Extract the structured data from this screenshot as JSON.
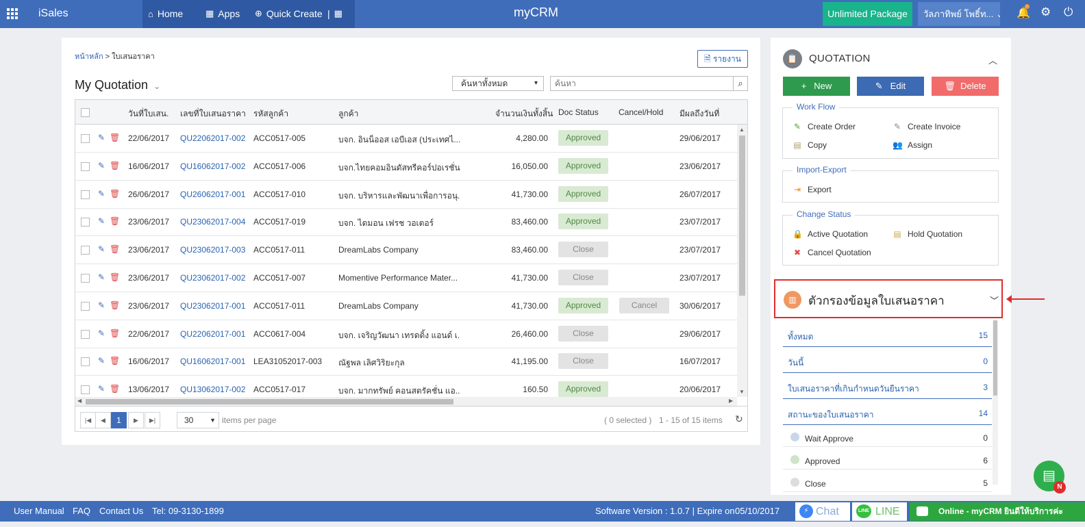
{
  "topbar": {
    "brand": "iSales",
    "nav": {
      "home": "Home",
      "apps": "Apps",
      "quick_create": "Quick Create"
    },
    "center_brand": "myCRM",
    "package": "Unlimited Package",
    "user": "วัลภาทิพย์ โพธิ์ท... ⌄"
  },
  "breadcrumb": {
    "home": "หน้าหลัก",
    "sep": ">",
    "current": "ใบเสนอราคา"
  },
  "report_button": "รายงาน",
  "page_title": "My Quotation",
  "search": {
    "scope": "ค้นหาทั้งหมด",
    "placeholder": "ค้นหา"
  },
  "grid": {
    "columns": [
      "วันที่ใบเสน...",
      "เลขที่ใบเสนอราคา",
      "รหัสลูกค้า",
      "ลูกค้า",
      "จำนวนเงินทั้งสิ้น",
      "Doc Status",
      "Cancel/Hold",
      "มีผลถึงวันที่"
    ],
    "rows": [
      {
        "date": "22/06/2017",
        "number": "QU22062017-002",
        "code": "ACC0517-005",
        "customer": "บจก. อินน็ออส เอบีเอส (ประเทศไ...",
        "amount": "4,280.00",
        "status": "Approved",
        "hold": "",
        "until": "29/06/2017"
      },
      {
        "date": "16/06/2017",
        "number": "QU16062017-002",
        "code": "ACC0517-006",
        "customer": "บจก.ไทยคอมอินดัสทรีคอร์ปอเรชั่น",
        "amount": "16,050.00",
        "status": "Approved",
        "hold": "",
        "until": "23/06/2017"
      },
      {
        "date": "26/06/2017",
        "number": "QU26062017-001",
        "code": "ACC0517-010",
        "customer": "บจก. บริหารและพัฒนาเพื่อการอนุ...",
        "amount": "41,730.00",
        "status": "Approved",
        "hold": "",
        "until": "26/07/2017"
      },
      {
        "date": "23/06/2017",
        "number": "QU23062017-004",
        "code": "ACC0517-019",
        "customer": "บจก. ไดมอน เฟรช วอเตอร์",
        "amount": "83,460.00",
        "status": "Approved",
        "hold": "",
        "until": "23/07/2017"
      },
      {
        "date": "23/06/2017",
        "number": "QU23062017-003",
        "code": "ACC0517-011",
        "customer": "DreamLabs Company",
        "amount": "83,460.00",
        "status": "Close",
        "hold": "",
        "until": "23/07/2017"
      },
      {
        "date": "23/06/2017",
        "number": "QU23062017-002",
        "code": "ACC0517-007",
        "customer": "Momentive Performance Mater...",
        "amount": "41,730.00",
        "status": "Close",
        "hold": "",
        "until": "23/07/2017"
      },
      {
        "date": "23/06/2017",
        "number": "QU23062017-001",
        "code": "ACC0517-011",
        "customer": "DreamLabs Company",
        "amount": "41,730.00",
        "status": "Approved",
        "hold": "Cancel",
        "until": "30/06/2017"
      },
      {
        "date": "22/06/2017",
        "number": "QU22062017-001",
        "code": "ACC0617-004",
        "customer": "บจก. เจริญวัฒนา เทรดดิ้ง แอนด์ เ...",
        "amount": "26,460.00",
        "status": "Close",
        "hold": "",
        "until": "29/06/2017"
      },
      {
        "date": "16/06/2017",
        "number": "QU16062017-001",
        "code": "LEA31052017-003",
        "customer": "ณัฐพล เลิศวิริยะกุล",
        "amount": "41,195.00",
        "status": "Close",
        "hold": "",
        "until": "16/07/2017"
      },
      {
        "date": "13/06/2017",
        "number": "QU13062017-002",
        "code": "ACC0517-017",
        "customer": "บจก. มากทรัพย์ คอนสตรัคชั่น แอ...",
        "amount": "160.50",
        "status": "Approved",
        "hold": "",
        "until": "20/06/2017"
      }
    ]
  },
  "pager": {
    "page": "1",
    "page_size": "30",
    "per_page_label": "items per page",
    "selected": "( 0 selected )",
    "range": "1 - 15 of 15 items"
  },
  "side": {
    "title": "QUOTATION",
    "buttons": {
      "new": "New",
      "edit": "Edit",
      "delete": "Delete"
    },
    "workflow": {
      "title": "Work Flow",
      "create_order": "Create Order",
      "create_invoice": "Create Invoice",
      "copy": "Copy",
      "assign": "Assign"
    },
    "import_export": {
      "title": "Import-Export",
      "export": "Export"
    },
    "change_status": {
      "title": "Change Status",
      "active": "Active Quotation",
      "hold": "Hold Quotation",
      "cancel": "Cancel Quotation"
    },
    "filter": {
      "title": "ตัวกรองข้อมูลใบเสนอราคา",
      "rows": [
        {
          "label": "ทั้งหมด",
          "count": "15"
        },
        {
          "label": "วันนี้",
          "count": "0"
        },
        {
          "label": "ใบเสนอราคาที่เกินกำหนดวันยืนราคา",
          "count": "3"
        },
        {
          "label": "สถานะของใบเสนอราคา",
          "count": "14"
        }
      ],
      "statuses": [
        {
          "label": "Wait Approve",
          "count": "0",
          "color": "#c9d6ea"
        },
        {
          "label": "Approved",
          "count": "6",
          "color": "#cfe3c8"
        },
        {
          "label": "Close",
          "count": "5",
          "color": "#dcdcdc"
        }
      ]
    }
  },
  "fab_badge": "N",
  "footer": {
    "manual": "User Manual",
    "faq": "FAQ",
    "contact": "Contact Us",
    "tel": "Tel: 09-3130-1899",
    "version": "Software Version : 1.0.7 | Expire on",
    "expire": "05/10/2017",
    "chat": "Chat",
    "line": "LINE",
    "line_logo": "LINE",
    "online": "Online - myCRM ยินดีให้บริการค่ะ"
  },
  "colors": {
    "primary": "#3f6dba",
    "approved_bg": "#d9ead3",
    "close_bg": "#e3e3e3",
    "highlight": "#e02c2c"
  }
}
